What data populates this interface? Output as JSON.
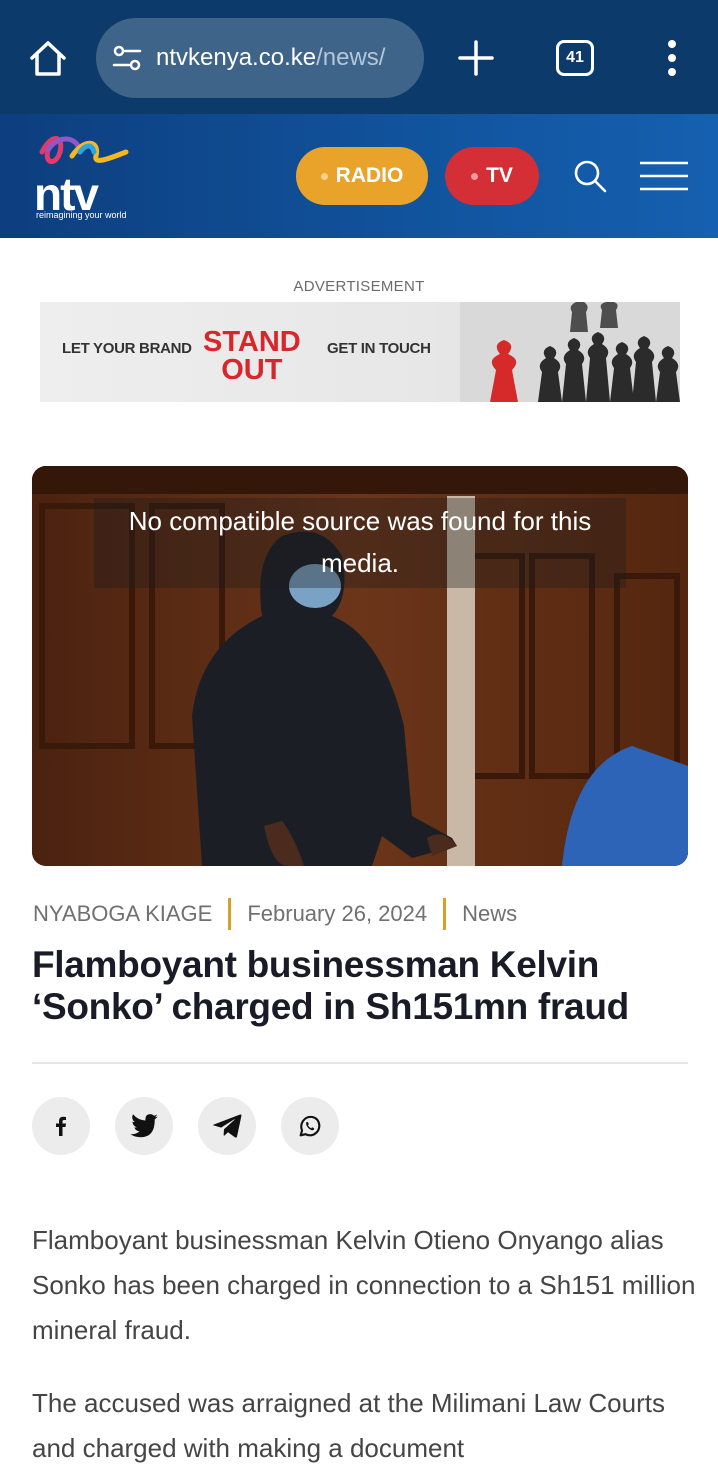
{
  "browser": {
    "url_host": "ntvkenya.co.ke",
    "url_path": "/news/",
    "tab_count": "41"
  },
  "site": {
    "logo_text": "ntv",
    "tagline": "reimagining your world",
    "radio_label": "RADIO",
    "tv_label": "TV",
    "colors": {
      "header": "#11549e",
      "radio": "#eaa32a",
      "tv": "#d42e37",
      "accent": "#d4a22b"
    }
  },
  "ad": {
    "label": "ADVERTISEMENT",
    "left_text": "LET YOUR BRAND",
    "stand": "STAND",
    "out": "OUT",
    "right_text": "GET IN TOUCH"
  },
  "media": {
    "message": "No compatible source was found for this media."
  },
  "article": {
    "author": "NYABOGA KIAGE",
    "date": "February 26, 2024",
    "category": "News",
    "headline": "Flamboyant businessman Kelvin ‘Sonko’ charged in Sh151mn fraud",
    "share_icons": [
      "facebook-icon",
      "twitter-icon",
      "telegram-icon",
      "whatsapp-icon"
    ],
    "paragraphs": [
      "Flamboyant businessman Kelvin Otieno Onyango alias Sonko has been charged in connection to a Sh151 million mineral fraud.",
      "The accused was arraigned at the Milimani Law Courts and charged with making a document"
    ]
  }
}
